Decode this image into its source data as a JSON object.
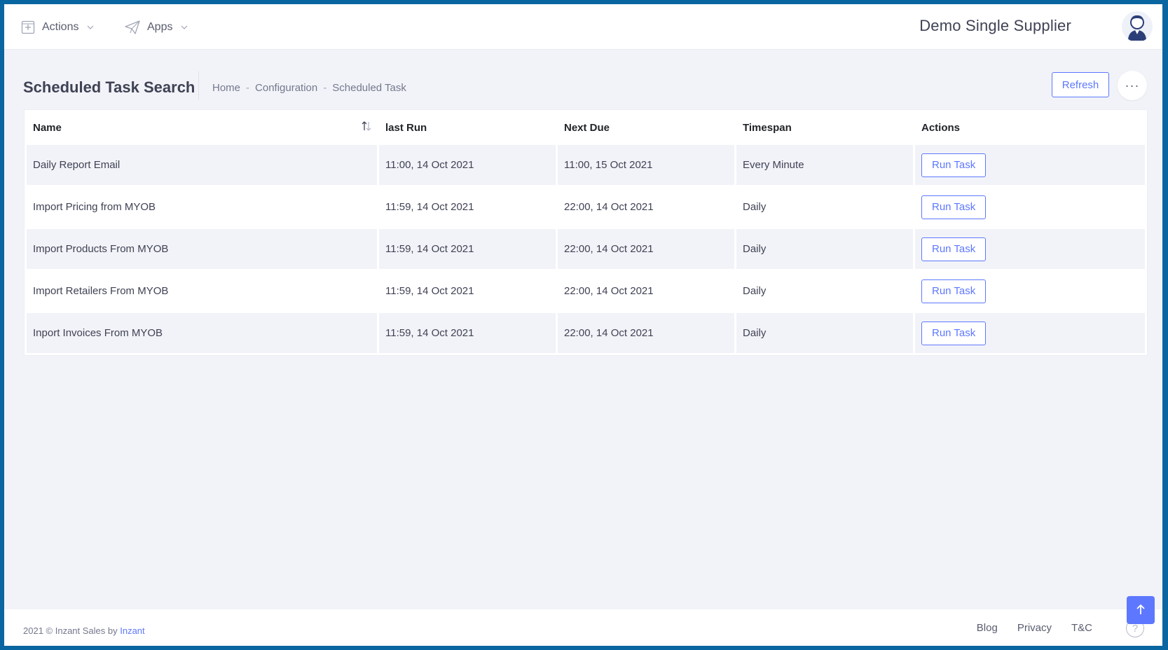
{
  "topbar": {
    "menu": [
      {
        "label": "Actions",
        "icon": "plus-square-icon"
      },
      {
        "label": "Apps",
        "icon": "paper-plane-icon"
      }
    ],
    "brand": "Demo Single Supplier",
    "avatar_icon": "user-avatar-icon"
  },
  "subheader": {
    "title": "Scheduled Task Search",
    "breadcrumb": [
      "Home",
      "Configuration",
      "Scheduled Task"
    ],
    "refresh_label": "Refresh",
    "more_label": "···"
  },
  "table": {
    "columns": [
      "Name",
      "last Run",
      "Next Due",
      "Timespan",
      "Actions"
    ],
    "action_label": "Run Task",
    "rows": [
      {
        "name": "Daily Report Email",
        "last_run": "11:00, 14 Oct 2021",
        "next_due": "11:00, 15 Oct 2021",
        "timespan": "Every Minute"
      },
      {
        "name": "Import Pricing from MYOB",
        "last_run": "11:59, 14 Oct 2021",
        "next_due": "22:00, 14 Oct 2021",
        "timespan": "Daily"
      },
      {
        "name": "Import Products From MYOB",
        "last_run": "11:59, 14 Oct 2021",
        "next_due": "22:00, 14 Oct 2021",
        "timespan": "Daily"
      },
      {
        "name": "Import Retailers From MYOB",
        "last_run": "11:59, 14 Oct 2021",
        "next_due": "22:00, 14 Oct 2021",
        "timespan": "Daily"
      },
      {
        "name": "Inport Invoices From MYOB",
        "last_run": "11:59, 14 Oct 2021",
        "next_due": "22:00, 14 Oct 2021",
        "timespan": "Daily"
      }
    ]
  },
  "footer": {
    "copyright_prefix": "2021 © Inzant Sales by ",
    "copyright_link": "Inzant",
    "links": [
      "Blog",
      "Privacy",
      "T&C"
    ],
    "help_label": "?"
  },
  "colors": {
    "frame_border": "#0a66a0",
    "accent": "#5d78ff",
    "page_bg": "#f2f3f8"
  }
}
